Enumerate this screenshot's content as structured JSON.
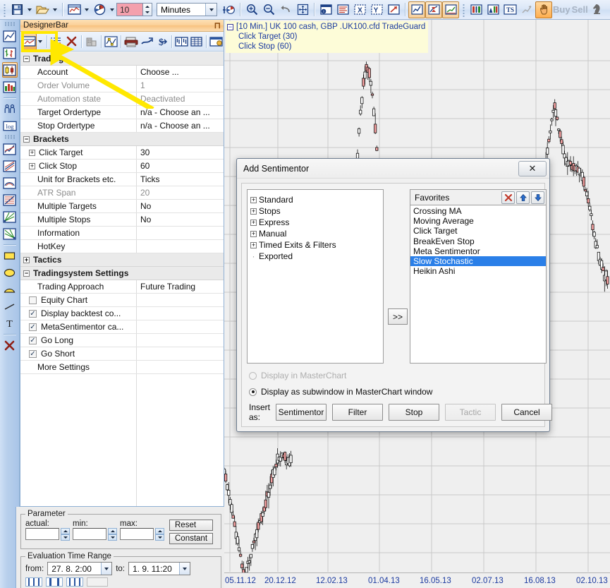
{
  "top_toolbar": {
    "save_icon": "save-disk-icon",
    "open_icon": "open-folder-icon",
    "chart_icon": "chart-window-icon",
    "clock_icon": "time-clock-icon",
    "interval_value": "10",
    "interval_unit": "Minutes",
    "add_icon": "add-instrument-icon",
    "zoom_in_icon": "zoom-in-icon",
    "zoom_out_icon": "zoom-out-icon",
    "undo_icon": "undo-icon",
    "pan_icon": "move-crosshair-icon",
    "info_icon": "info-window-icon",
    "list_icon": "list-lines-icon",
    "x_icon": "x-axis-icon",
    "y_icon": "y-axis-icon",
    "expand_icon": "expand-arrow-icon",
    "line_chart_icon": "line-chart-icon",
    "hourglass_chart_icon": "hourglass-chart-icon",
    "trend_chart_icon": "trend-chart-icon",
    "depth_icon": "market-depth-icon",
    "depth2_icon": "market-depth-2-icon",
    "ts_icon": "tradeguard-ts-icon",
    "scatter_icon": "scatter-icon",
    "hand_icon": "hand-tool-icon",
    "buy_label": "Buy",
    "sell_label": "Sell",
    "chess_icon": "chess-knight-icon"
  },
  "left_toolbar": {
    "items": [
      {
        "icon": "line-chart-icon",
        "selected": false
      },
      {
        "icon": "bar-chart-icon",
        "selected": false
      },
      {
        "icon": "candlestick-chart-icon",
        "selected": true
      },
      {
        "icon": "colored-bars-icon",
        "selected": false
      },
      {
        "icon": "people-sentiment-icon",
        "selected": false
      },
      {
        "icon": "log-scale-icon",
        "selected": false
      },
      {
        "icon": "trendline-up-icon",
        "selected": false
      },
      {
        "icon": "channel-icon",
        "selected": false
      },
      {
        "icon": "arc-fan-icon",
        "selected": false
      },
      {
        "icon": "fibonacci-icon",
        "selected": false
      },
      {
        "icon": "gann-fan-icon",
        "selected": false
      },
      {
        "icon": "gann-fan-2-icon",
        "selected": false
      },
      {
        "icon": "rectangle-icon",
        "selected": false
      },
      {
        "icon": "ellipse-icon",
        "selected": false
      },
      {
        "icon": "arc-icon",
        "selected": false
      },
      {
        "icon": "line-icon",
        "selected": false
      },
      {
        "icon": "text-tool-icon",
        "selected": false
      },
      {
        "icon": "delete-x-icon",
        "selected": false
      }
    ]
  },
  "designer": {
    "title": "DesignerBar",
    "pin_icon": "pin-icon",
    "toolbar": [
      {
        "icon": "new-sentimentor-icon",
        "active": true,
        "has_dropdown": true
      },
      {
        "icon": "list-properties-icon",
        "active": false
      },
      {
        "icon": "delete-red-x-icon",
        "active": false
      },
      {
        "icon": "building-icon",
        "active": false
      },
      {
        "icon": "curve-point-icon",
        "active": false
      },
      {
        "icon": "printer-icon",
        "active": false
      },
      {
        "icon": "wrench-icon",
        "active": false
      },
      {
        "icon": "dollar-arrow-icon",
        "active": false
      },
      {
        "icon": "bars-window-icon",
        "active": false
      },
      {
        "icon": "table-icon",
        "active": false
      },
      {
        "icon": "euro-window-icon",
        "active": false
      }
    ],
    "properties": [
      {
        "kind": "category",
        "label": "Trading",
        "expanded": true
      },
      {
        "kind": "prop",
        "label": "Account",
        "value": "Choose ...",
        "dim": false
      },
      {
        "kind": "prop",
        "label": "Order Volume",
        "value": "1",
        "dim": true
      },
      {
        "kind": "prop",
        "label": "Automation state",
        "value": "Deactivated",
        "dim": true
      },
      {
        "kind": "prop",
        "label": "Target Ordertype",
        "value": "n/a - Choose an ...",
        "dim": false
      },
      {
        "kind": "prop",
        "label": "Stop Ordertype",
        "value": "n/a - Choose an ...",
        "dim": false
      },
      {
        "kind": "category",
        "label": "Brackets",
        "expanded": true
      },
      {
        "kind": "expandable",
        "label": "Click Target",
        "value": "30",
        "dim": false
      },
      {
        "kind": "expandable",
        "label": "Click Stop",
        "value": "60",
        "dim": false
      },
      {
        "kind": "prop",
        "label": "Unit for Brackets etc.",
        "value": "Ticks",
        "dim": false
      },
      {
        "kind": "prop",
        "label": "ATR Span",
        "value": "20",
        "dim": true
      },
      {
        "kind": "prop",
        "label": "Multiple Targets",
        "value": "No",
        "dim": false
      },
      {
        "kind": "prop",
        "label": "Multiple Stops",
        "value": "No",
        "dim": false
      },
      {
        "kind": "prop",
        "label": "Information",
        "value": "",
        "dim": false
      },
      {
        "kind": "prop",
        "label": "HotKey",
        "value": "",
        "dim": false
      },
      {
        "kind": "category",
        "label": "Tactics",
        "expanded": false
      },
      {
        "kind": "category",
        "label": "Tradingsystem Settings",
        "expanded": true
      },
      {
        "kind": "prop",
        "label": "Trading Approach",
        "value": "Future Trading",
        "dim": false
      },
      {
        "kind": "check",
        "label": "Equity Chart",
        "value": "",
        "checked": false
      },
      {
        "kind": "check",
        "label": "Display backtest co...",
        "value": "",
        "checked": true
      },
      {
        "kind": "check",
        "label": "MetaSentimentor ca...",
        "value": "",
        "checked": true
      },
      {
        "kind": "check",
        "label": "Go Long",
        "value": "",
        "checked": true
      },
      {
        "kind": "check",
        "label": "Go Short",
        "value": "",
        "checked": true
      },
      {
        "kind": "prop",
        "label": "More Settings",
        "value": "",
        "dim": false
      }
    ]
  },
  "parameter_panel": {
    "legend": "Parameter",
    "actual_label": "actual:",
    "actual_value": "",
    "min_label": "min:",
    "min_value": "",
    "max_label": "max:",
    "max_value": "",
    "reset_label": "Reset",
    "constant_label": "Constant"
  },
  "evaluation_panel": {
    "legend": "Evaluation Time Range",
    "from_label": "from:",
    "from_value": "27. 8.   2:00",
    "to_label": "to:",
    "to_value": "1. 9. 11:20"
  },
  "chart": {
    "legend_title": "[10 Min.] UK 100 cash, GBP   .UK100.cfd TradeGuard",
    "legend_lines": [
      "Click Target  (30)",
      "Click Stop  (60)"
    ],
    "collapse_icon": "collapse-box-icon",
    "x_labels": [
      "05.11.12",
      "20.12.12",
      "12.02.13",
      "01.04.13",
      "16.05.13",
      "02.07.13",
      "16.08.13",
      "02.10.13"
    ],
    "up_color": "#ffffff",
    "down_color": "#f4a0a0",
    "outline_color": "#000000",
    "grid_color": "#c8c8c8",
    "background": "#efefef"
  },
  "dialog": {
    "title": "Add Sentimentor",
    "close_label": "✕",
    "tree_nodes": [
      {
        "label": "Standard",
        "expandable": true
      },
      {
        "label": "Stops",
        "expandable": true
      },
      {
        "label": "Express",
        "expandable": true
      },
      {
        "label": "Manual",
        "expandable": true
      },
      {
        "label": "Timed Exits & Filters",
        "expandable": true
      },
      {
        "label": "Exported",
        "expandable": false
      }
    ],
    "favorites_label": "Favorites",
    "fav_delete_icon": "red-x-icon",
    "fav_up_icon": "arrow-up-icon",
    "fav_down_icon": "arrow-down-icon",
    "move_button": ">>",
    "favorites": [
      {
        "label": "Crossing MA",
        "selected": false
      },
      {
        "label": "Moving Average",
        "selected": false
      },
      {
        "label": "Click Target",
        "selected": false
      },
      {
        "label": "BreakEven Stop",
        "selected": false
      },
      {
        "label": "Meta Sentimentor",
        "selected": false
      },
      {
        "label": "Slow Stochastic",
        "selected": true
      },
      {
        "label": "Heikin Ashi",
        "selected": false
      }
    ],
    "radio_master": "Display in MasterChart",
    "radio_master_enabled": false,
    "radio_master_selected": false,
    "radio_subwindow": "Display as subwindow in MasterChart window",
    "radio_subwindow_selected": true,
    "insert_label": "Insert as:",
    "buttons": [
      {
        "label": "Sentimentor",
        "disabled": false
      },
      {
        "label": "Filter",
        "disabled": false
      },
      {
        "label": "Stop",
        "disabled": false
      },
      {
        "label": "Tactic",
        "disabled": true
      },
      {
        "label": "Cancel",
        "disabled": false
      }
    ]
  },
  "annotation": {
    "highlight_color": "#ffe800",
    "arrow_color": "#ffe800",
    "target": "new-sentimentor-toolbar-button"
  },
  "chart_data": {
    "type": "candlestick",
    "title": "[10 Min.] UK 100 cash, GBP   .UK100.cfd TradeGuard",
    "xlabel": "",
    "ylabel": "",
    "x_tick_labels": [
      "05.11.12",
      "20.12.12",
      "12.02.13",
      "01.04.13",
      "16.05.13",
      "02.07.13",
      "16.08.13",
      "02.10.13"
    ],
    "grid": true,
    "legend_position": "top-left",
    "note": "Price candlestick series; visible portion shows a tall spike mid-upper area, scattered clusters, and a deep V-shaped trough at lower-left of the visible window."
  }
}
